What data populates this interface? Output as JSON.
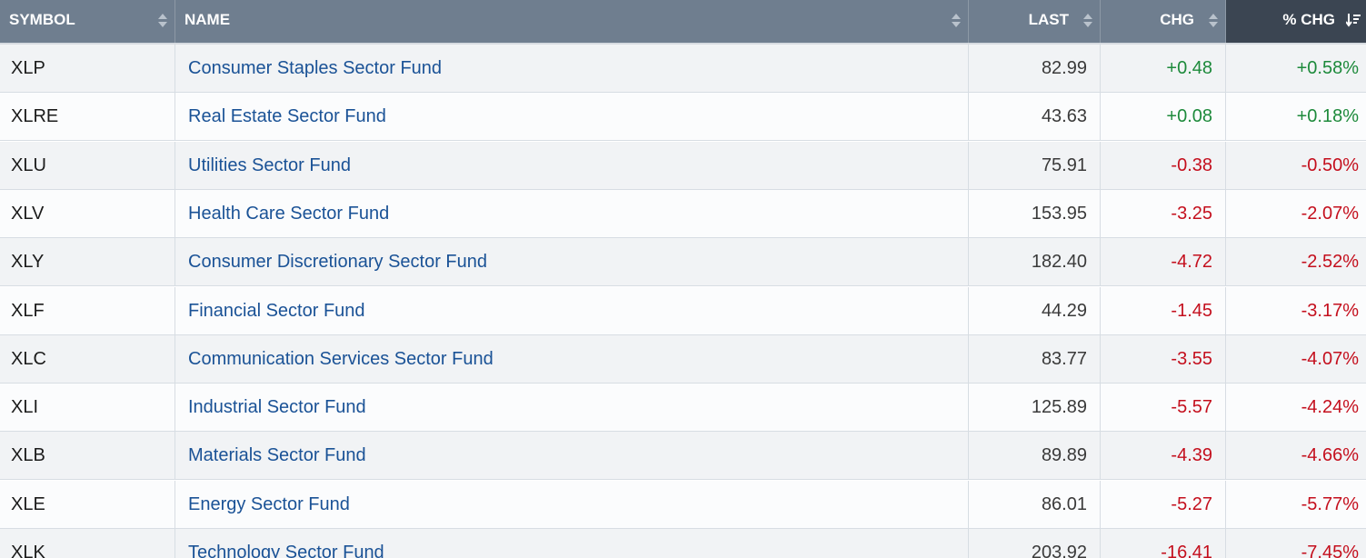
{
  "header": {
    "symbol": "SYMBOL",
    "name": "NAME",
    "last": "LAST",
    "chg": "CHG",
    "pct_chg": "% CHG"
  },
  "colors": {
    "up": "#1d8a3b",
    "down": "#c40f1d",
    "link": "#1a5296",
    "header_bg": "#6f7e8f",
    "active_header_bg": "#3b4552"
  },
  "rows": [
    {
      "symbol": "XLP",
      "name": "Consumer Staples Sector Fund",
      "last": "82.99",
      "chg": "+0.48",
      "pct": "+0.58%",
      "dir": "up"
    },
    {
      "symbol": "XLRE",
      "name": "Real Estate Sector Fund",
      "last": "43.63",
      "chg": "+0.08",
      "pct": "+0.18%",
      "dir": "up"
    },
    {
      "symbol": "XLU",
      "name": "Utilities Sector Fund",
      "last": "75.91",
      "chg": "-0.38",
      "pct": "-0.50%",
      "dir": "down"
    },
    {
      "symbol": "XLV",
      "name": "Health Care Sector Fund",
      "last": "153.95",
      "chg": "-3.25",
      "pct": "-2.07%",
      "dir": "down"
    },
    {
      "symbol": "XLY",
      "name": "Consumer Discretionary Sector Fund",
      "last": "182.40",
      "chg": "-4.72",
      "pct": "-2.52%",
      "dir": "down"
    },
    {
      "symbol": "XLF",
      "name": "Financial Sector Fund",
      "last": "44.29",
      "chg": "-1.45",
      "pct": "-3.17%",
      "dir": "down"
    },
    {
      "symbol": "XLC",
      "name": "Communication Services Sector Fund",
      "last": "83.77",
      "chg": "-3.55",
      "pct": "-4.07%",
      "dir": "down"
    },
    {
      "symbol": "XLI",
      "name": "Industrial Sector Fund",
      "last": "125.89",
      "chg": "-5.57",
      "pct": "-4.24%",
      "dir": "down"
    },
    {
      "symbol": "XLB",
      "name": "Materials Sector Fund",
      "last": "89.89",
      "chg": "-4.39",
      "pct": "-4.66%",
      "dir": "down"
    },
    {
      "symbol": "XLE",
      "name": "Energy Sector Fund",
      "last": "86.01",
      "chg": "-5.27",
      "pct": "-5.77%",
      "dir": "down"
    },
    {
      "symbol": "XLK",
      "name": "Technology Sector Fund",
      "last": "203.92",
      "chg": "-16.41",
      "pct": "-7.45%",
      "dir": "down"
    }
  ]
}
